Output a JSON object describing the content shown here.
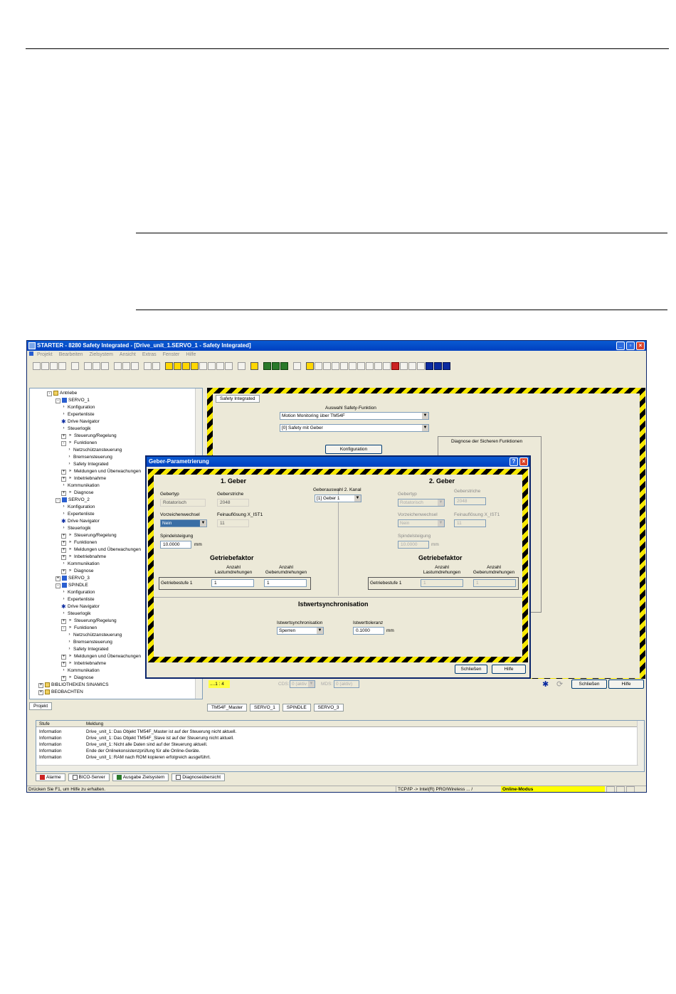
{
  "app": {
    "title": "STARTER - 8280 Safety Integrated - [Drive_unit_1.SERVO_1 - Safety Integrated]",
    "window_controls": [
      "_",
      "▫",
      "×"
    ],
    "menu": [
      "Projekt",
      "Bearbeiten",
      "Zielsystem",
      "Ansicht",
      "Extras",
      "Fenster",
      "Hilfe"
    ]
  },
  "tree": {
    "items": [
      {
        "label": "Antriebe",
        "icon": "folder-icon"
      },
      {
        "label": "SERVO_1",
        "icon": "drive-icon"
      },
      {
        "label": "Konfiguration",
        "icon": "chevron-icon"
      },
      {
        "label": "Expertenliste",
        "icon": "chevron-icon"
      },
      {
        "label": "Drive Navigator",
        "icon": "gear-icon"
      },
      {
        "label": "Steuerlogik",
        "icon": "chevron-icon"
      },
      {
        "label": "Steuerung/Regelung",
        "icon": "double-chevron-icon"
      },
      {
        "label": "Funktionen",
        "icon": "double-chevron-icon"
      },
      {
        "label": "Netzschützansteuerung",
        "icon": "chevron-icon"
      },
      {
        "label": "Bremsensteuerung",
        "icon": "chevron-icon"
      },
      {
        "label": "Safety Integrated",
        "icon": "chevron-icon"
      },
      {
        "label": "Meldungen und Überwachungen",
        "icon": "double-chevron-icon"
      },
      {
        "label": "Inbetriebnahme",
        "icon": "double-chevron-icon"
      },
      {
        "label": "Kommunikation",
        "icon": "chevron-icon"
      },
      {
        "label": "Diagnose",
        "icon": "double-chevron-icon"
      },
      {
        "label": "SERVO_2",
        "icon": "drive-icon"
      },
      {
        "label": "Konfiguration",
        "icon": "chevron-icon"
      },
      {
        "label": "Expertenliste",
        "icon": "chevron-icon"
      },
      {
        "label": "Drive Navigator",
        "icon": "gear-icon"
      },
      {
        "label": "Steuerlogik",
        "icon": "chevron-icon"
      },
      {
        "label": "Steuerung/Regelung",
        "icon": "double-chevron-icon"
      },
      {
        "label": "Funktionen",
        "icon": "double-chevron-icon"
      },
      {
        "label": "Meldungen und Überwachungen",
        "icon": "double-chevron-icon"
      },
      {
        "label": "Inbetriebnahme",
        "icon": "double-chevron-icon"
      },
      {
        "label": "Kommunikation",
        "icon": "chevron-icon"
      },
      {
        "label": "Diagnose",
        "icon": "double-chevron-icon"
      },
      {
        "label": "SERVO_3",
        "icon": "drive-icon"
      },
      {
        "label": "SPINDLE",
        "icon": "drive-icon"
      },
      {
        "label": "Konfiguration",
        "icon": "chevron-icon"
      },
      {
        "label": "Expertenliste",
        "icon": "chevron-icon"
      },
      {
        "label": "Drive Navigator",
        "icon": "gear-icon"
      },
      {
        "label": "Steuerlogik",
        "icon": "chevron-icon"
      },
      {
        "label": "Steuerung/Regelung",
        "icon": "double-chevron-icon"
      },
      {
        "label": "Funktionen",
        "icon": "double-chevron-icon"
      },
      {
        "label": "Netzschützansteuerung",
        "icon": "chevron-icon"
      },
      {
        "label": "Bremsensteuerung",
        "icon": "chevron-icon"
      },
      {
        "label": "Safety Integrated",
        "icon": "chevron-icon"
      },
      {
        "label": "Meldungen und Überwachungen",
        "icon": "double-chevron-icon"
      },
      {
        "label": "Inbetriebnahme",
        "icon": "double-chevron-icon"
      },
      {
        "label": "Kommunikation",
        "icon": "chevron-icon"
      },
      {
        "label": "Diagnose",
        "icon": "double-chevron-icon"
      },
      {
        "label": "BIBLIOTHEKEN SINAMICS",
        "icon": "folder-icon"
      },
      {
        "label": "BEOBACHTEN",
        "icon": "folder-icon"
      }
    ],
    "tab": "Projekt"
  },
  "safety": {
    "tab": "Safety Integrated",
    "select_label": "Auswahl Safety-Funktion",
    "select1": "Motion Monitoring über TM54F",
    "select2": "[0] Safety mit Geber",
    "konfiguration_button": "Konfiguration",
    "diag_title": "Diagnose der Sicheren Funktionen"
  },
  "dialog": {
    "title": "Geber-Parametrierung",
    "help_icon": "?",
    "close_icon": "×",
    "g1": {
      "header": "1. Geber",
      "gebertyp_label": "Gebertyp",
      "gebertyp_value": "Rotatorisch",
      "geberstriche_label": "Geberstriche",
      "geberstriche_value": "2048",
      "vorzeichen_label": "Vorzeichenwechsel",
      "vorzeichen_value": "Nein",
      "fein_label": "Feinauflösung X_IST1",
      "fein_value": "11",
      "spindel_label": "Spindelsteigung",
      "spindel_value": "10.0000",
      "spindel_unit": "mm",
      "getriebe_header": "Getriebefaktor",
      "last_label": "Anzahl\nLastumdrehungen",
      "geber_label": "Anzahl\nGeberumdrehungen",
      "getriebestufe_label": "Getriebestufe 1",
      "last_value": "1",
      "geber_value": "1"
    },
    "geberauswahl_label": "Geberauswahl 2. Kanal",
    "geberauswahl_value": "[1] Geber 1",
    "g2": {
      "header": "2. Geber",
      "gebertyp_label": "Gebertyp",
      "gebertyp_value": "Rotatorisch",
      "geberstriche_label": "Geberstriche",
      "geberstriche_value": "2048",
      "vorzeichen_label": "Vorzeichenwechsel",
      "vorzeichen_value": "Nein",
      "fein_label": "Feinauflösung X_IST1",
      "fein_value": "11",
      "spindel_label": "Spindelsteigung",
      "spindel_value": "10.0000",
      "spindel_unit": "mm",
      "getriebe_header": "Getriebefaktor",
      "last_label": "Anzahl\nLastumdrehungen",
      "geber_label": "Anzahl\nGeberumdrehungen",
      "getriebestufe_label": "Getriebestufe 1",
      "last_value": "1",
      "geber_value": "1"
    },
    "ist": {
      "header": "Istwertsynchronisation",
      "sync_label": "Istwertsynchronisation",
      "sync_value": "Sperren",
      "tol_label": "Istwerttoleranz",
      "tol_value": "0.1000",
      "tol_unit": "mm"
    },
    "close_button": "Schließen",
    "help_button": "Hilfe"
  },
  "bottom": {
    "counter": "....1 : 4",
    "cds_label": "CDS:",
    "cds_value": "0 (aktiv",
    "mds_label": "MDS:",
    "mds_value": "0 (aktiv)",
    "close_button": "Schließen",
    "help_button": "Hilfe"
  },
  "doc_tabs": [
    "TM54F_Master",
    "SERVO_1",
    "SPINDLE",
    "SERVO_3"
  ],
  "log": {
    "col_stufe": "Stufe",
    "col_meldung": "Meldung",
    "rows": [
      {
        "stufe": "Information",
        "meldung": "Drive_unit_1: Das Objekt TM54F_Master ist auf der Steuerung nicht aktuell."
      },
      {
        "stufe": "Information",
        "meldung": "Drive_unit_1: Das Objekt TM54F_Slave ist auf der Steuerung nicht aktuell."
      },
      {
        "stufe": "Information",
        "meldung": "Drive_unit_1: Nicht alle Daten sind auf der Steuerung aktuell."
      },
      {
        "stufe": "Information",
        "meldung": "Ende der Onlinekonsistenzprüfung für alle Online-Geräte."
      },
      {
        "stufe": "Information",
        "meldung": "Drive_unit_1: RAM nach ROM kopieren erfolgreich ausgeführt."
      }
    ]
  },
  "bottom_tabs": [
    "Alarme",
    "BICO-Server",
    "Ausgabe Zielsystem",
    "Diagnoseübersicht"
  ],
  "status": {
    "hint": "Drücken Sie F1, um Hilfe zu erhalten.",
    "connection": "TCP/IP -> Intel(R) PRO/Wireless ... /",
    "mode": "Online-Modus"
  },
  "colors": {
    "titlebar": "#0a5ad2",
    "hazard_yellow": "#f6e800",
    "online_mode": "#ffff00"
  }
}
